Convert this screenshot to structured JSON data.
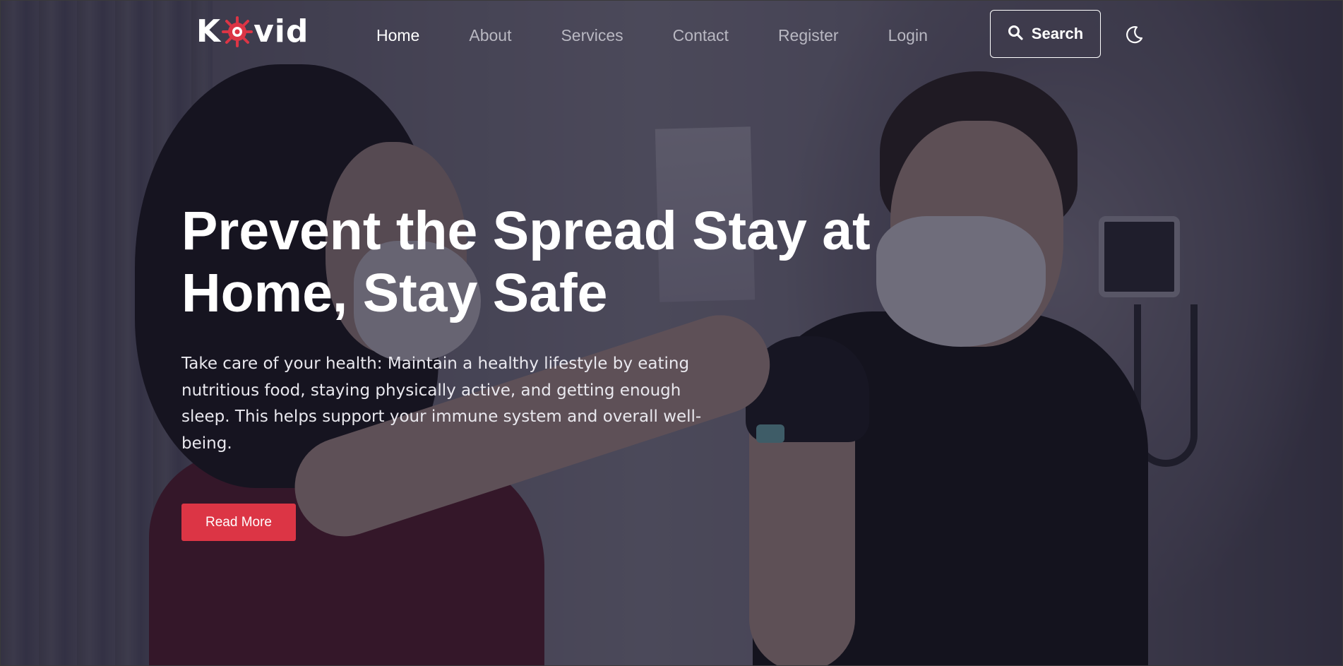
{
  "brand": {
    "name_before_icon": "K",
    "name_after_icon": "vid",
    "icon": "virus-icon",
    "icon_color": "#dc3545"
  },
  "nav": {
    "items": [
      {
        "label": "Home",
        "active": true
      },
      {
        "label": "About",
        "active": false
      },
      {
        "label": "Services",
        "active": false
      },
      {
        "label": "Contact",
        "active": false
      },
      {
        "label": "Register",
        "active": false
      },
      {
        "label": "Login",
        "active": false
      }
    ],
    "search_label": "Search",
    "search_icon": "search-icon",
    "theme_icon": "moon-icon"
  },
  "hero": {
    "title": "Prevent the Spread Stay at Home, Stay Safe",
    "description": "Take care of your health: Maintain a healthy lifestyle by eating nutritious food, staying physically active, and getting enough sleep. This helps support your immune system and overall well-being.",
    "cta_label": "Read More",
    "cta_color": "#dc3545"
  }
}
